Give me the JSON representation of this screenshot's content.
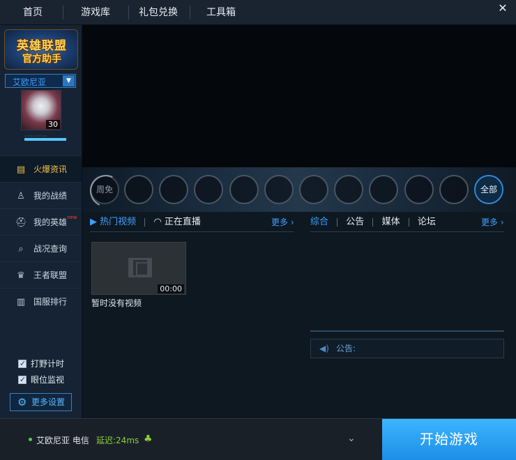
{
  "topnav": {
    "tabs": [
      "首页",
      "游戏库",
      "礼包兑换",
      "工具箱"
    ],
    "close_glyph": "✕"
  },
  "sidebar": {
    "logo_line1": "英雄联盟",
    "logo_line2": "官方助手",
    "server": "艾欧尼亚",
    "level": "30",
    "menu": [
      {
        "label": "火爆资讯",
        "icon": "news-icon",
        "active": true
      },
      {
        "label": "我的战绩",
        "icon": "user-icon",
        "active": false
      },
      {
        "label": "我的英雄",
        "icon": "helmet-icon",
        "active": false,
        "badge": "new"
      },
      {
        "label": "战况查询",
        "icon": "search-icon",
        "active": false
      },
      {
        "label": "王者联盟",
        "icon": "crown-icon",
        "active": false
      },
      {
        "label": "国服排行",
        "icon": "bar-chart-icon",
        "active": false
      }
    ],
    "checkboxes": [
      {
        "label": "打野计时",
        "checked": true
      },
      {
        "label": "眼位监视",
        "checked": true
      }
    ],
    "more_settings": "更多设置"
  },
  "heroes": {
    "free_label": "周免",
    "all_label": "全部",
    "empty_slots": 10
  },
  "videos": {
    "tab_hot": "热门视频",
    "tab_live": "正在直播",
    "more": "更多",
    "duration": "00:00",
    "empty_text": "暂时没有视频"
  },
  "news": {
    "tabs": [
      "综合",
      "公告",
      "媒体",
      "论坛"
    ],
    "more": "更多",
    "notice_label": "公告:"
  },
  "bottombar": {
    "server_status": "艾欧尼亚 电信",
    "latency": "延迟:24ms",
    "start_button": "开始游戏"
  },
  "colors": {
    "accent": "#3ea0ff",
    "active_menu": "#f0c04a",
    "start_button": "#2aa2f6"
  }
}
